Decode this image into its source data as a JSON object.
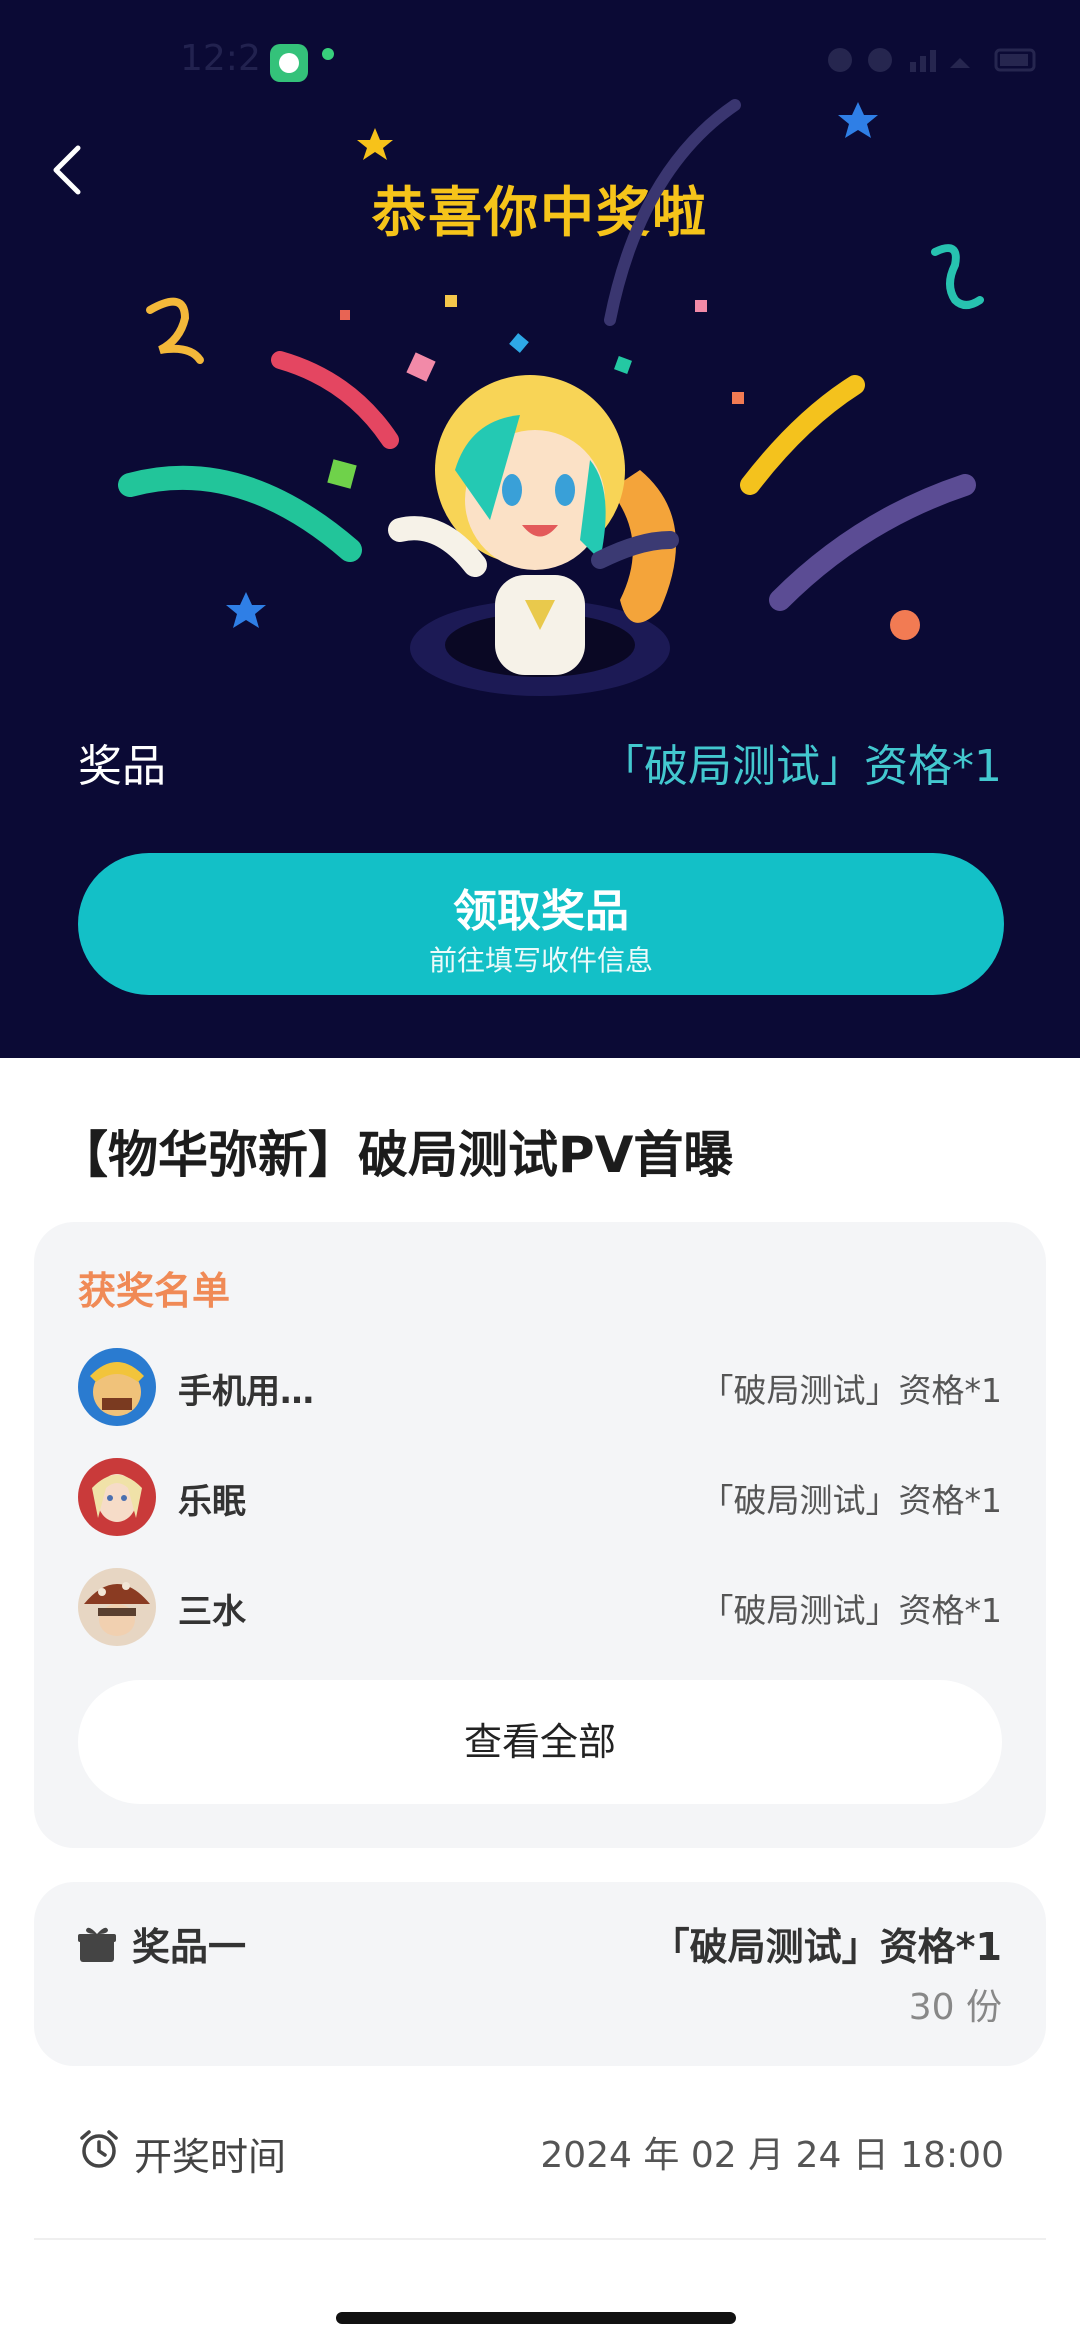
{
  "status_bar": {
    "time": "12:2",
    "right_text": ""
  },
  "hero": {
    "title": "恭喜你中奖啦",
    "prize_label": "奖品",
    "prize_value": "「破局测试」资格*1",
    "claim_button": {
      "label": "领取奖品",
      "sub": "前往填写收件信息"
    }
  },
  "event": {
    "title": "【物华弥新】破局测试PV首曝"
  },
  "winners": {
    "title": "获奖名单",
    "list": [
      {
        "name": "手机用…",
        "prize": "「破局测试」资格*1"
      },
      {
        "name": "乐眠",
        "prize": "「破局测试」资格*1"
      },
      {
        "name": "三水",
        "prize": "「破局测试」资格*1"
      }
    ],
    "view_all": "查看全部"
  },
  "prize_detail": {
    "label": "奖品一",
    "value": "「破局测试」资格*1",
    "count": "30 份"
  },
  "draw_time": {
    "label": "开奖时间",
    "value": "2024 年 02 月 24 日 18:00"
  },
  "colors": {
    "hero_bg": "#0b0a35",
    "title_gold": "#f6c41a",
    "accent_teal": "#13c0c7",
    "winners_orange": "#f08a56"
  }
}
